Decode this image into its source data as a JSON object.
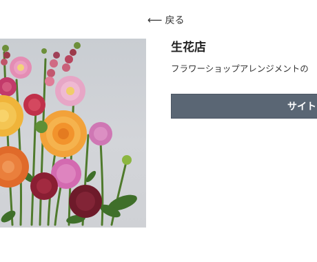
{
  "nav": {
    "back_arrow": "⟵",
    "back_label": "戻る"
  },
  "shop": {
    "title": "生花店",
    "description": "フラワーショップアレンジメントの",
    "site_button_label": "サイト"
  },
  "photo": {
    "subject": "flower-arrangement-photo",
    "background_color": "#cfd2d6",
    "accent_colors": [
      "#f2a23a",
      "#c23a4e",
      "#e27bb0",
      "#6e1a2a",
      "#e06a2a",
      "#4d7a2e"
    ]
  },
  "theme": {
    "button_color": "#5a6674",
    "button_text_color": "#ffffff"
  }
}
